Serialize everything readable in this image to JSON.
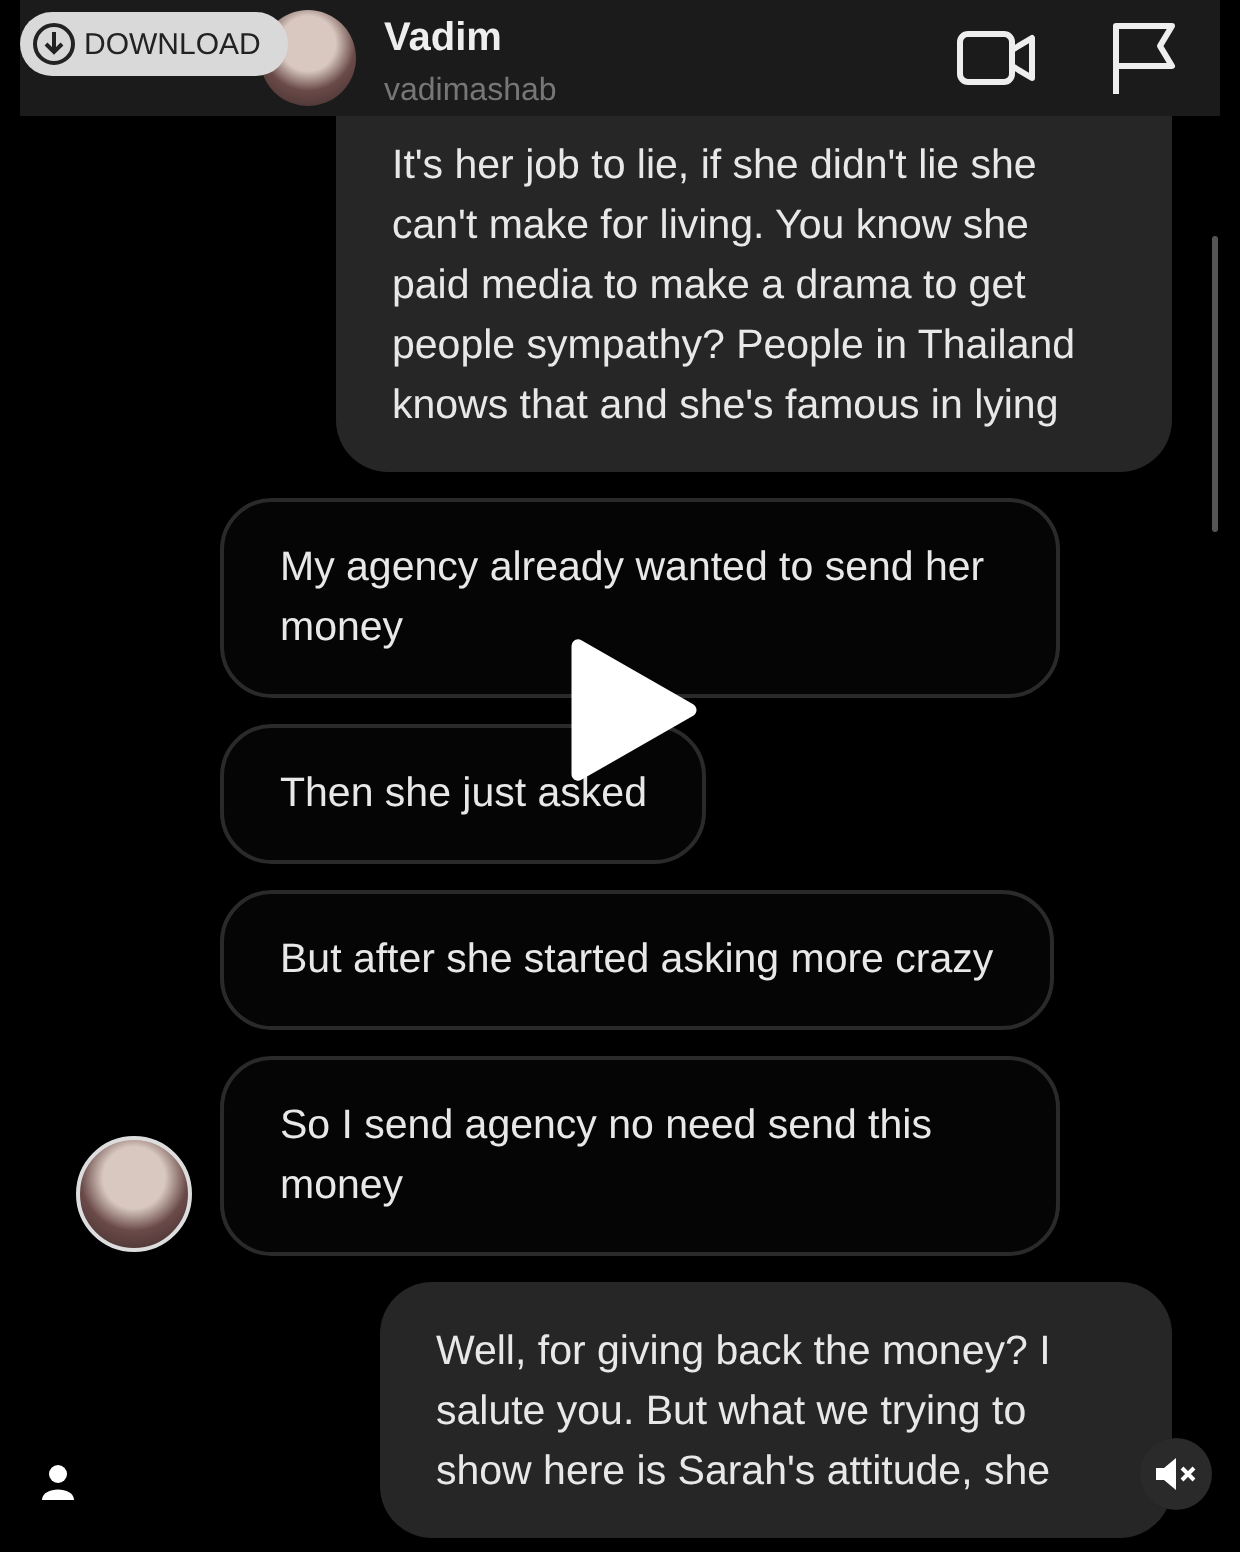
{
  "header": {
    "name": "Vadim",
    "username": "vadimashab"
  },
  "overlay": {
    "download_label": "DOWNLOAD"
  },
  "messages": [
    {
      "kind": "filled",
      "text": "It's her job to lie, if she didn't lie she can't make for living. You know she paid media to make a drama to get people sympathy? People in Thailand knows that and she's famous in lying"
    },
    {
      "kind": "outlined",
      "text": "My agency already wanted to send her money"
    },
    {
      "kind": "outlined",
      "text": "Then she just asked"
    },
    {
      "kind": "outlined",
      "text": "But after she started asking more crazy"
    },
    {
      "kind": "outlined",
      "text": "So I send agency no need send this money",
      "avatar": true
    },
    {
      "kind": "filled",
      "text": "Well, for giving back the money? I salute you. But what we trying to show here is Sarah's attitude, she"
    }
  ]
}
